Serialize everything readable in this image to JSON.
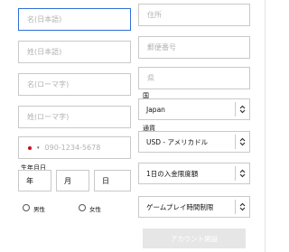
{
  "form": {
    "left": {
      "first_name_ja_placeholder": "名(日本語)",
      "last_name_ja_placeholder": "姓(日本語)",
      "first_name_romaji_placeholder": "名(ローマ字)",
      "last_name_romaji_placeholder": "姓(ローマ字)",
      "phone_placeholder": "090-1234-5678",
      "birth_date_label": "生年月日",
      "year_label": "年",
      "month_label": "月",
      "day_label": "日",
      "gender_male": "男性",
      "gender_female": "女性"
    },
    "right": {
      "address_placeholder": "住所",
      "postal_code_placeholder": "郵便番号",
      "prefecture_placeholder": "県",
      "country_label": "国",
      "country_value": "Japan",
      "currency_label": "通貨",
      "currency_value": "USD - アメリカドル",
      "deposit_limit_value": "1日の入金限度額",
      "playtime_limit_value": "ゲームプレイ時間制限"
    },
    "submit_label": "アカウント開設"
  },
  "colors": {
    "focus_border": "#2e6fd8",
    "field_border": "#c9c9c9",
    "placeholder_text": "#b2b2b2",
    "submit_disabled_bg": "#e6e6e6",
    "flag_red": "#d0021b"
  }
}
